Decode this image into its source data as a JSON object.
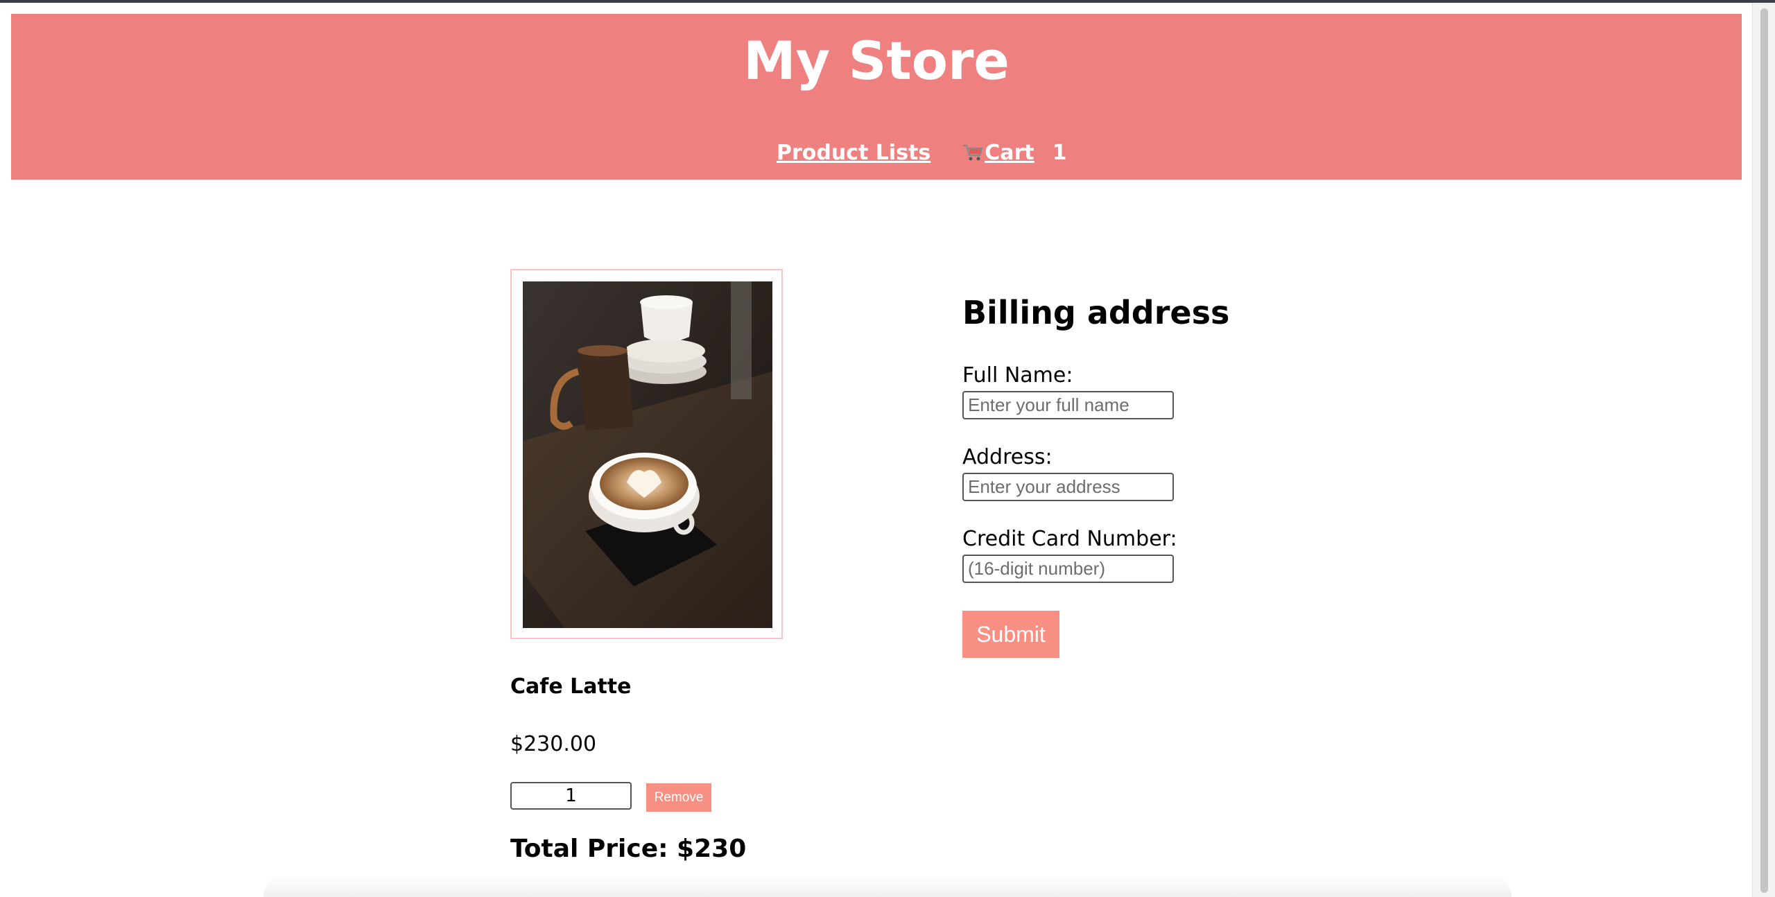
{
  "header": {
    "title": "My Store",
    "nav": {
      "product_lists": "Product Lists",
      "cart_label": "Cart",
      "cart_count": "1"
    }
  },
  "cart": {
    "item": {
      "name": "Cafe Latte",
      "price": "$230.00",
      "quantity": "1",
      "remove_label": "Remove"
    },
    "total": "Total Price: $230"
  },
  "billing": {
    "title": "Billing address",
    "full_name": {
      "label": "Full Name:",
      "placeholder": "Enter your full name"
    },
    "address": {
      "label": "Address:",
      "placeholder": "Enter your address"
    },
    "credit_card": {
      "label": "Credit Card Number:",
      "placeholder": "(16-digit number)"
    },
    "submit_label": "Submit"
  },
  "colors": {
    "header_bg": "#ef8080",
    "button_bg": "#f79083",
    "frame_border": "#f6c5c5"
  }
}
